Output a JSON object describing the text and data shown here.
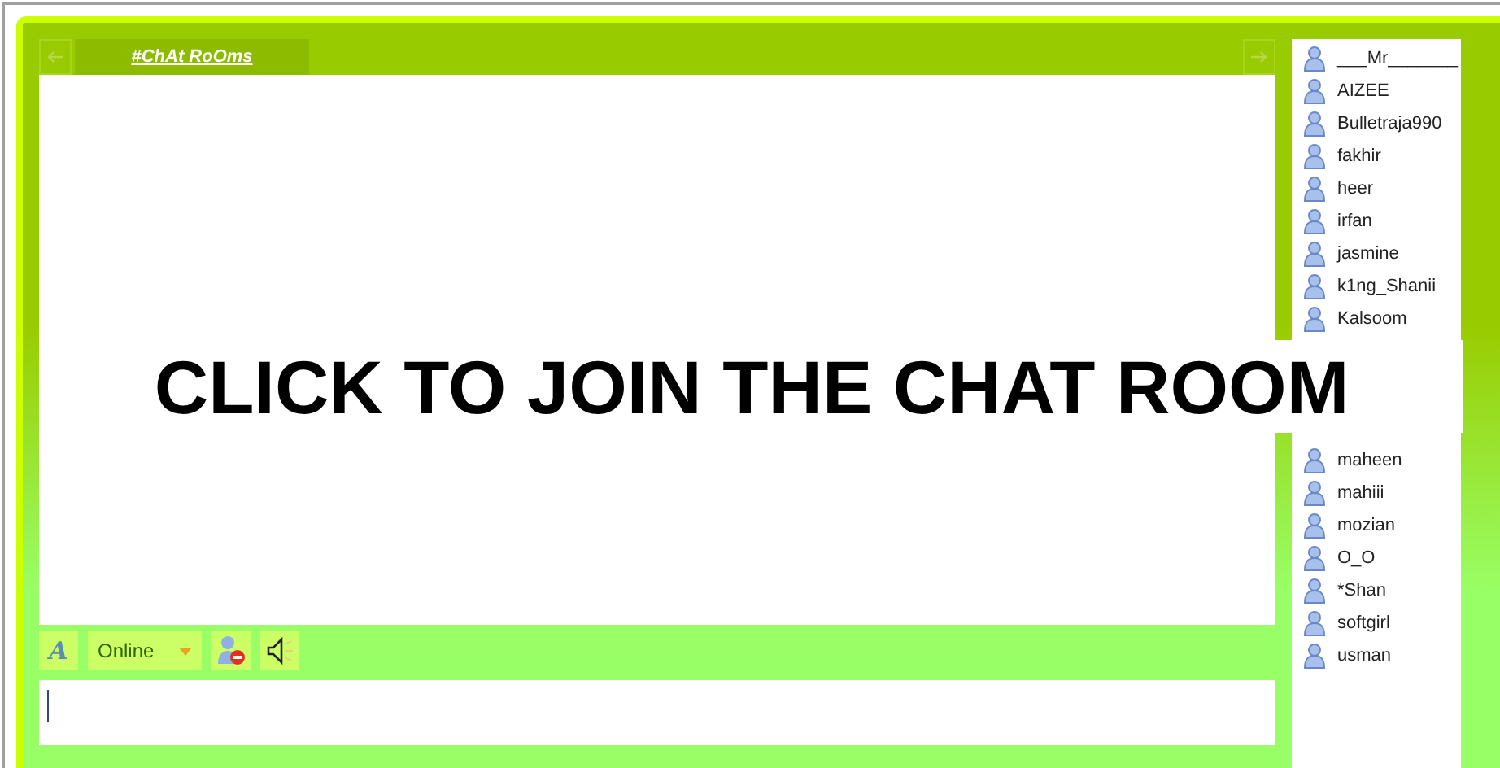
{
  "tab": {
    "label": "#ChAt RoOms",
    "selected": true
  },
  "users": [
    {
      "name": "___Mr_______"
    },
    {
      "name": "AIZEE"
    },
    {
      "name": "Bulletraja990"
    },
    {
      "name": "fakhir"
    },
    {
      "name": "heer"
    },
    {
      "name": "irfan"
    },
    {
      "name": "jasmine"
    },
    {
      "name": "k1ng_Shanii"
    },
    {
      "name": "Kalsoom"
    },
    {
      "name": "maheen"
    },
    {
      "name": "mahiii"
    },
    {
      "name": "mozian"
    },
    {
      "name": "O_O"
    },
    {
      "name": "*Shan"
    },
    {
      "name": "softgirl"
    },
    {
      "name": "usman"
    }
  ],
  "toolbar": {
    "font_button": "A",
    "status": "Online"
  },
  "overlay": {
    "text": "CLICK TO JOIN THE CHAT ROOM"
  }
}
